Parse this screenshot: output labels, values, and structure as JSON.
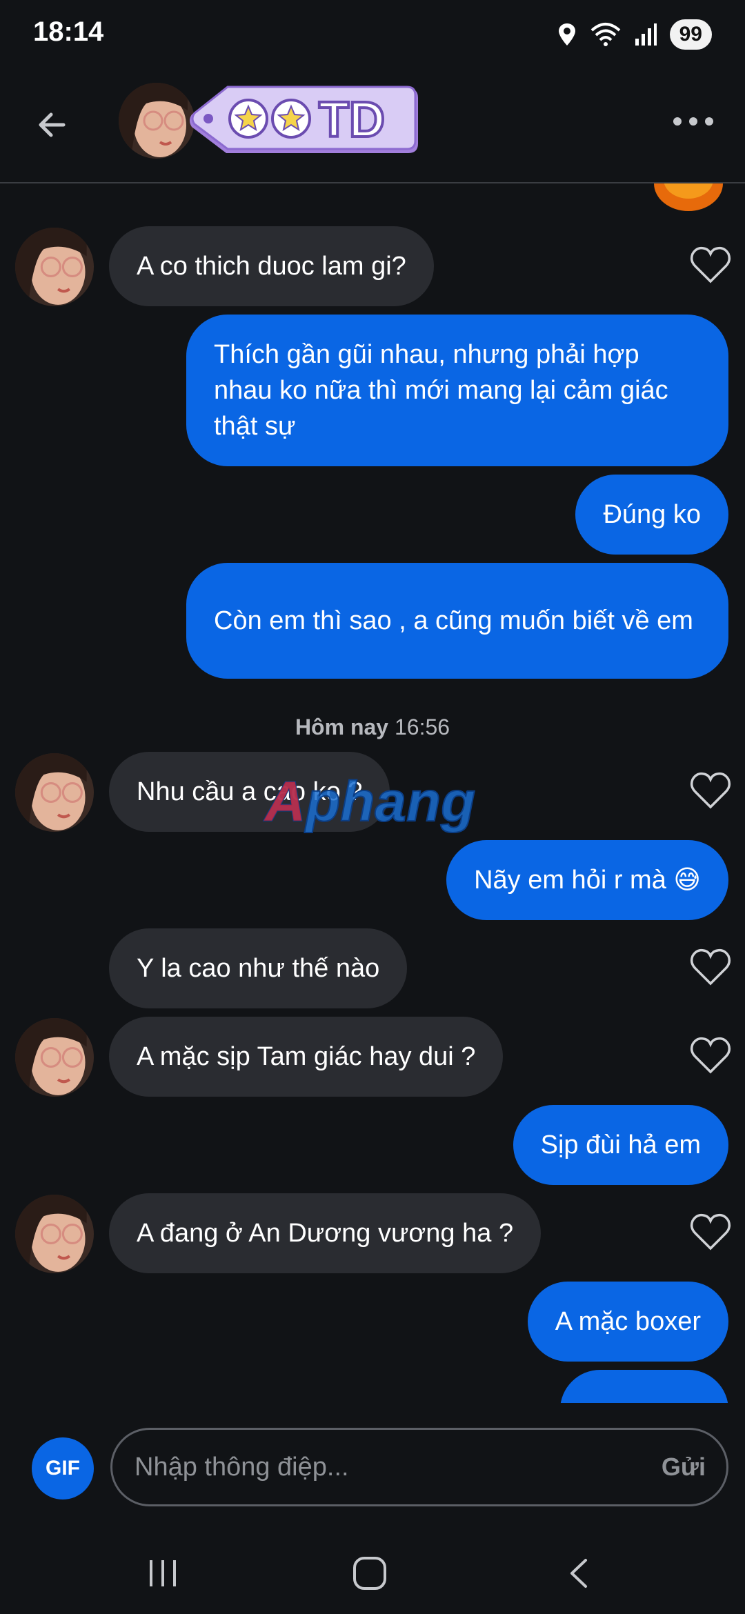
{
  "status_bar": {
    "time": "18:14",
    "battery": "99"
  },
  "header": {
    "tag_text": "TD"
  },
  "messages": [
    {
      "side": "in",
      "text": "A co thich duoc lam gi?"
    },
    {
      "side": "out",
      "text": "Thích gần gũi nhau, nhưng phải hợp nhau ko nữa thì mới mang lại cảm giác thật sự"
    },
    {
      "side": "out",
      "text": "Đúng ko"
    },
    {
      "side": "out",
      "text": "Còn em thì sao , a cũng muốn biết về em"
    },
    {
      "side": "in",
      "text": "Nhu cầu a cao ko ?"
    },
    {
      "side": "out",
      "text": "Nãy em hỏi r mà 😅"
    },
    {
      "side": "in",
      "text": "Y la cao như thế nào"
    },
    {
      "side": "in",
      "text": "A mặc sịp Tam giác hay dui ?"
    },
    {
      "side": "out",
      "text": "Sịp đùi hả em"
    },
    {
      "side": "in",
      "text": "A đang ở An Dương vương ha ?"
    },
    {
      "side": "out",
      "text": "A mặc boxer"
    }
  ],
  "timestamp": {
    "day": "Hôm nay",
    "time": "16:56"
  },
  "watermark": "Aphang",
  "composer": {
    "gif_label": "GIF",
    "placeholder": "Nhập thông điệp...",
    "send_label": "Gửi"
  },
  "colors": {
    "background": "#111316",
    "outgoing_bubble": "#0a66e4",
    "incoming_bubble": "#2a2c31",
    "tag_purple": "#c9b8ef"
  }
}
